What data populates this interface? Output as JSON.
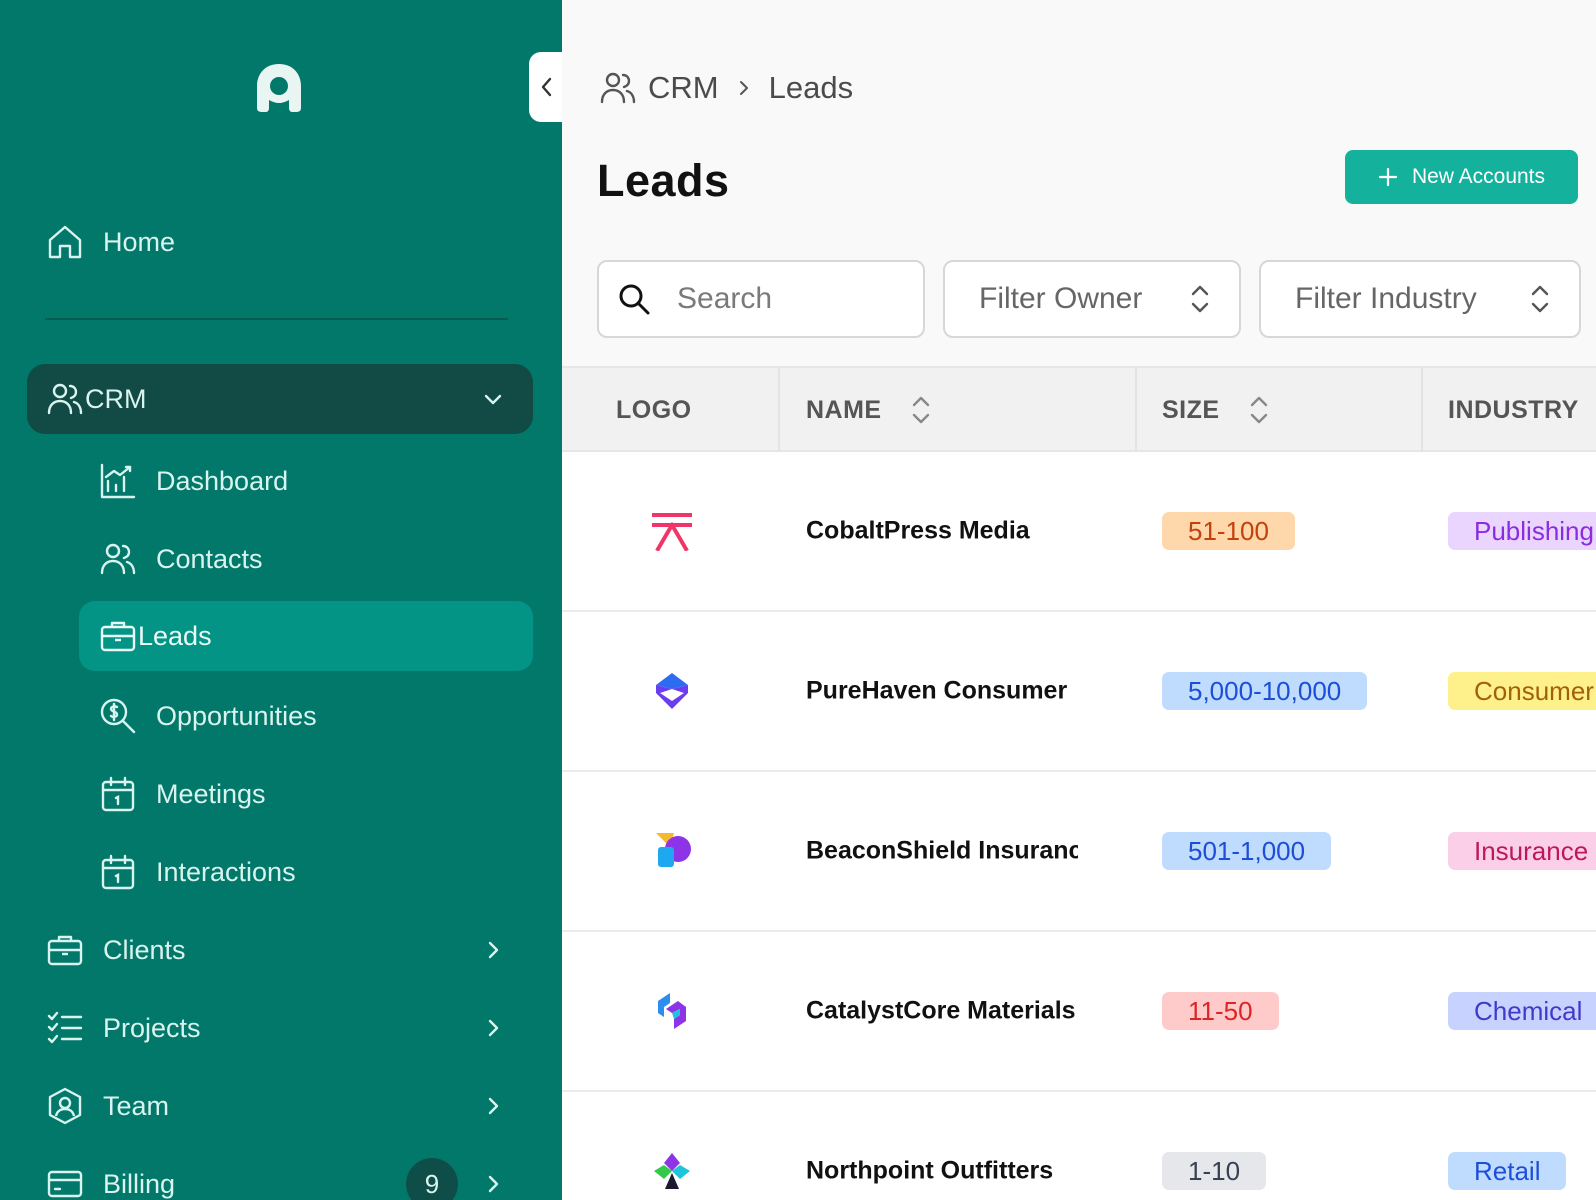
{
  "sidebar": {
    "home": "Home",
    "crm": "CRM",
    "crm_items": {
      "dashboard": "Dashboard",
      "contacts": "Contacts",
      "leads": "Leads",
      "opportunities": "Opportunities",
      "meetings": "Meetings",
      "interactions": "Interactions"
    },
    "clients": "Clients",
    "projects": "Projects",
    "team": "Team",
    "billing": "Billing",
    "billing_badge": "9"
  },
  "breadcrumb": {
    "root": "CRM",
    "current": "Leads"
  },
  "page": {
    "title": "Leads",
    "new_button": "New Accounts"
  },
  "filters": {
    "search_placeholder": "Search",
    "owner": "Filter Owner",
    "industry": "Filter Industry"
  },
  "table": {
    "headers": {
      "logo": "LOGO",
      "name": "NAME",
      "size": "SIZE",
      "industry": "INDUSTRY"
    },
    "rows": [
      {
        "name": "CobaltPress Media",
        "size": "51-100",
        "industry": "Publishing"
      },
      {
        "name": "PureHaven Consumer",
        "size": "5,000-10,000",
        "industry": "Consumer"
      },
      {
        "name": "BeaconShield Insurance",
        "size": "501-1,000",
        "industry": "Insurance"
      },
      {
        "name": "CatalystCore Materials",
        "size": "11-50",
        "industry": "Chemical"
      },
      {
        "name": "Northpoint Outfitters",
        "size": "1-10",
        "industry": "Retail"
      }
    ]
  },
  "colors": {
    "sidebar_bg": "#02786b",
    "sidebar_group_bg": "#124a45",
    "active_item_bg": "#039486",
    "primary_button": "#14b29d"
  }
}
